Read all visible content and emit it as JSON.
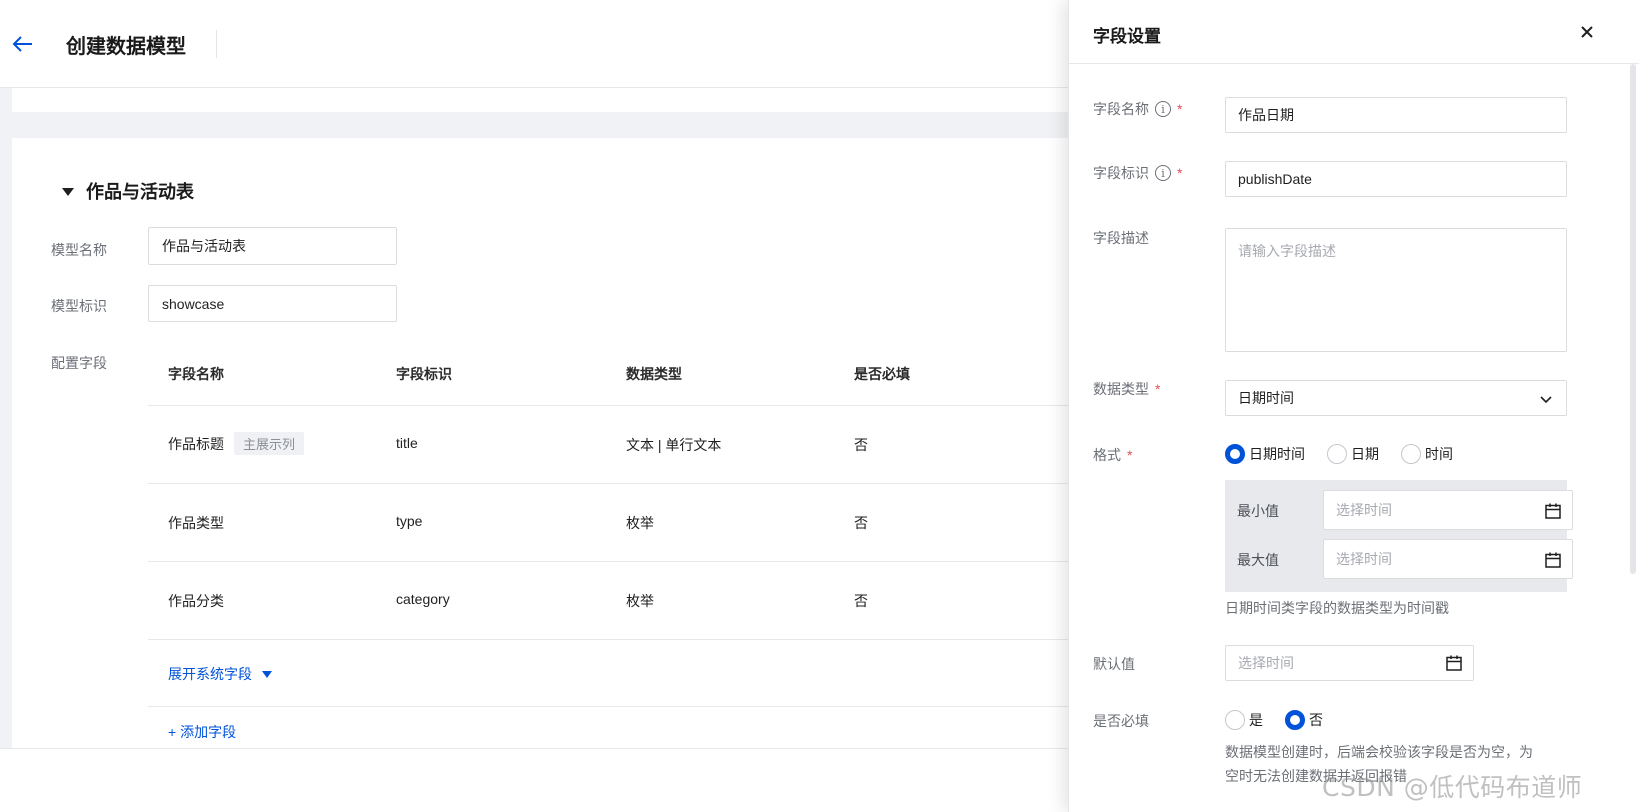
{
  "header": {
    "back_icon": "arrow-left-icon",
    "title": "创建数据模型"
  },
  "model": {
    "section_title": "作品与活动表",
    "name_label": "模型名称",
    "name_value": "作品与活动表",
    "id_label": "模型标识",
    "id_value": "showcase",
    "fields_label": "配置字段"
  },
  "table": {
    "columns": [
      "字段名称",
      "字段标识",
      "数据类型",
      "是否必填"
    ],
    "rows": [
      {
        "name": "作品标题",
        "tag": "主展示列",
        "id": "title",
        "type": "文本 | 单行文本",
        "required": "否"
      },
      {
        "name": "作品类型",
        "tag": "",
        "id": "type",
        "type": "枚举",
        "required": "否"
      },
      {
        "name": "作品分类",
        "tag": "",
        "id": "category",
        "type": "枚举",
        "required": "否"
      }
    ],
    "expand_system": "展开系统字段",
    "add_field": "+ 添加字段"
  },
  "drawer": {
    "title": "字段设置",
    "close_icon": "close-icon",
    "field_name_label": "字段名称",
    "field_name_value": "作品日期",
    "field_id_label": "字段标识",
    "field_id_value": "publishDate",
    "field_desc_label": "字段描述",
    "field_desc_placeholder": "请输入字段描述",
    "data_type_label": "数据类型",
    "data_type_value": "日期时间",
    "format_label": "格式",
    "format_options": [
      "日期时间",
      "日期",
      "时间"
    ],
    "format_selected": "日期时间",
    "min_label": "最小值",
    "max_label": "最大值",
    "time_placeholder": "选择时间",
    "datetime_hint": "日期时间类字段的数据类型为时间戳",
    "default_label": "默认值",
    "required_label": "是否必填",
    "required_options": [
      "是",
      "否"
    ],
    "required_selected": "否",
    "required_hint_line1": "数据模型创建时，后端会校验该字段是否为空，为",
    "required_hint_line2": "空时无法创建数据并返回报错",
    "required_mark": "*",
    "info_mark": "i"
  },
  "watermark": "CSDN @低代码布道师",
  "colors": {
    "primary": "#0052d9",
    "required": "#e34d59"
  }
}
